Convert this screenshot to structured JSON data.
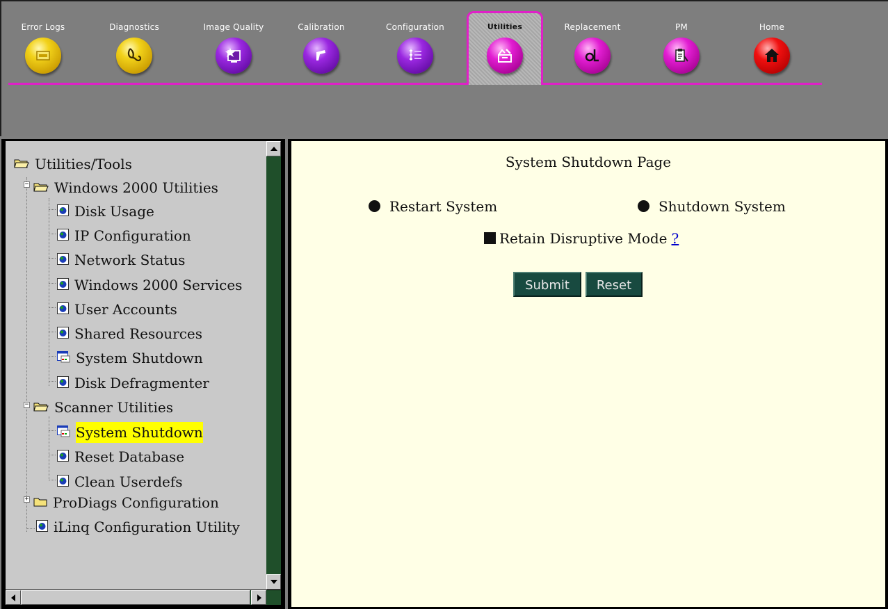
{
  "toolbar": {
    "tabs": [
      {
        "label": "Error Logs",
        "icon": "error-log-icon",
        "color": "#e8c000"
      },
      {
        "label": "Diagnostics",
        "icon": "stethoscope-icon",
        "color": "#e8c000"
      },
      {
        "label": "Image Quality",
        "icon": "image-quality-icon",
        "color": "#8a1ad0"
      },
      {
        "label": "Calibration",
        "icon": "calibration-icon",
        "color": "#8a1ad0"
      },
      {
        "label": "Configuration",
        "icon": "configuration-icon",
        "color": "#8a1ad0"
      },
      {
        "label": "Utilities",
        "icon": "utilities-icon",
        "color": "#d418c8",
        "active": true
      },
      {
        "label": "Replacement",
        "icon": "replacement-icon",
        "color": "#d418c8"
      },
      {
        "label": "PM",
        "icon": "pm-icon",
        "color": "#d418c8"
      },
      {
        "label": "Home",
        "icon": "home-icon",
        "color": "#e01010"
      }
    ],
    "accent_color": "#e020c8"
  },
  "tree": {
    "root": "Utilities/Tools",
    "groups": [
      {
        "label": "Windows 2000 Utilities",
        "expanded": true,
        "items": [
          "Disk Usage",
          "IP Configuration",
          "Network Status",
          "Windows 2000 Services",
          "User Accounts",
          "Shared Resources",
          "System Shutdown",
          "Disk Defragmenter"
        ]
      },
      {
        "label": "Scanner Utilities",
        "expanded": true,
        "items": [
          "System Shutdown",
          "Reset Database",
          "Clean Userdefs"
        ]
      },
      {
        "label": "ProDiags Configuration",
        "expanded": false,
        "items": []
      }
    ],
    "standalone": "iLinq Configuration Utility",
    "selected": "System Shutdown",
    "highlight_color": "#ffff00"
  },
  "content": {
    "title": "System Shutdown Page",
    "restart_label": "Restart System",
    "shutdown_label": "Shutdown System",
    "retain_label": "Retain Disruptive Mode",
    "help_link": "?",
    "submit_label": "Submit",
    "reset_label": "Reset",
    "background": "#ffffe6"
  }
}
